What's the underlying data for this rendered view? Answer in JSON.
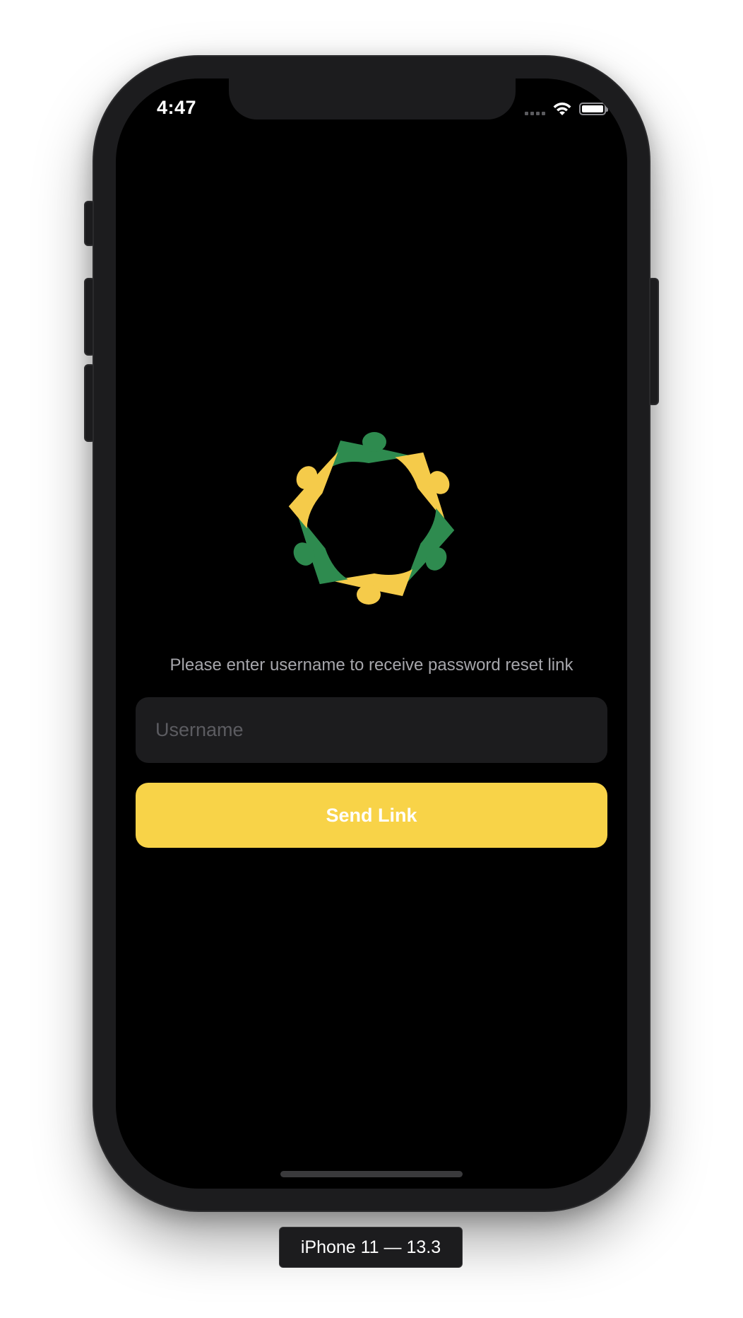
{
  "status_bar": {
    "time": "4:47",
    "icons": [
      "cellular-signal-icon",
      "wifi-icon",
      "battery-icon"
    ]
  },
  "logo": {
    "icon": "people-circle-logo",
    "colors": {
      "green": "#2e8b4f",
      "yellow": "#f5cb4a"
    }
  },
  "reset": {
    "prompt": "Please enter username to receive password reset link",
    "username_placeholder": "Username",
    "username_value": "",
    "send_label": "Send Link"
  },
  "device": {
    "label": "iPhone 11 — 13.3"
  },
  "colors": {
    "background": "#000000",
    "field_bg": "#1c1c1e",
    "accent": "#f8d348",
    "prompt_text": "#a6a6ab"
  }
}
